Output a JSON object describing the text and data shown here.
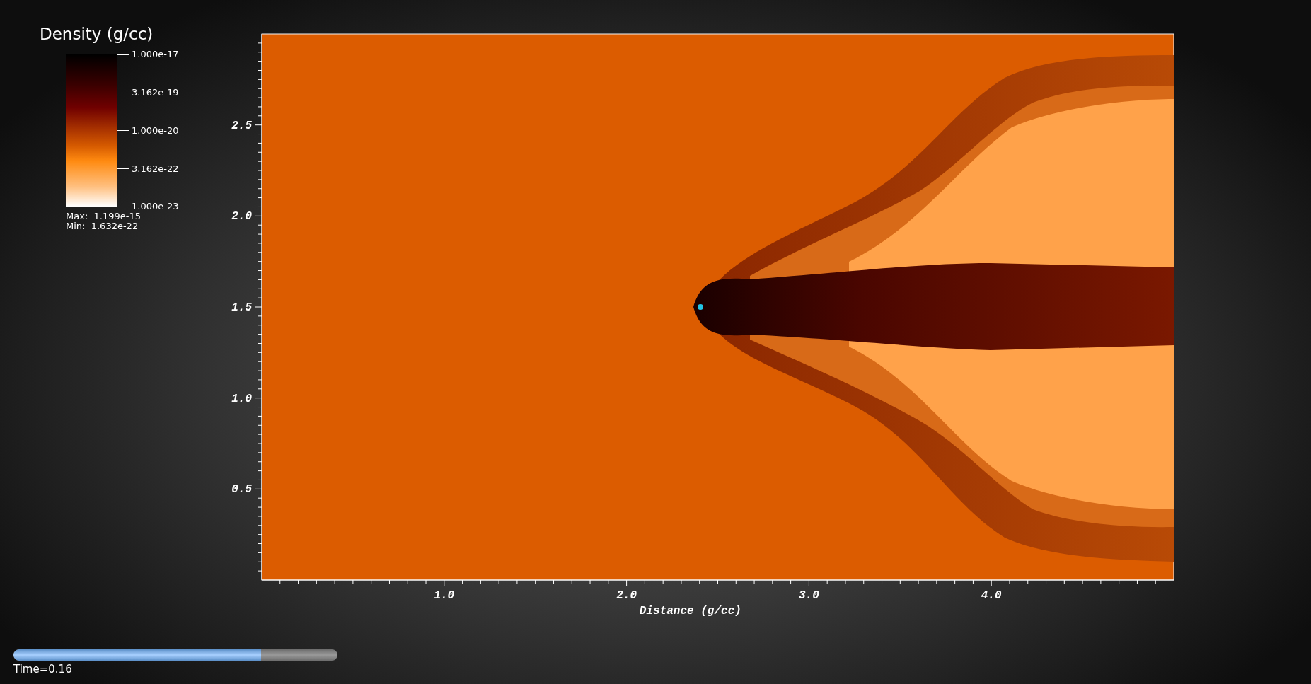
{
  "legend": {
    "title": "Density (g/cc)",
    "tick_labels": [
      "1.000e-17",
      "3.162e-19",
      "1.000e-20",
      "3.162e-22",
      "1.000e-23"
    ],
    "max": "Max:  1.199e-15",
    "min": "Min:  1.632e-22"
  },
  "plot": {
    "x_tick_labels": [
      "1.0",
      "2.0",
      "3.0",
      "4.0"
    ],
    "y_tick_labels": [
      "2.5",
      "2.0",
      "1.5",
      "1.0",
      "0.5"
    ],
    "xlabel": "Distance (g/cc)"
  },
  "time_slider": {
    "level": 0.765,
    "label": "Time=0.16"
  }
}
